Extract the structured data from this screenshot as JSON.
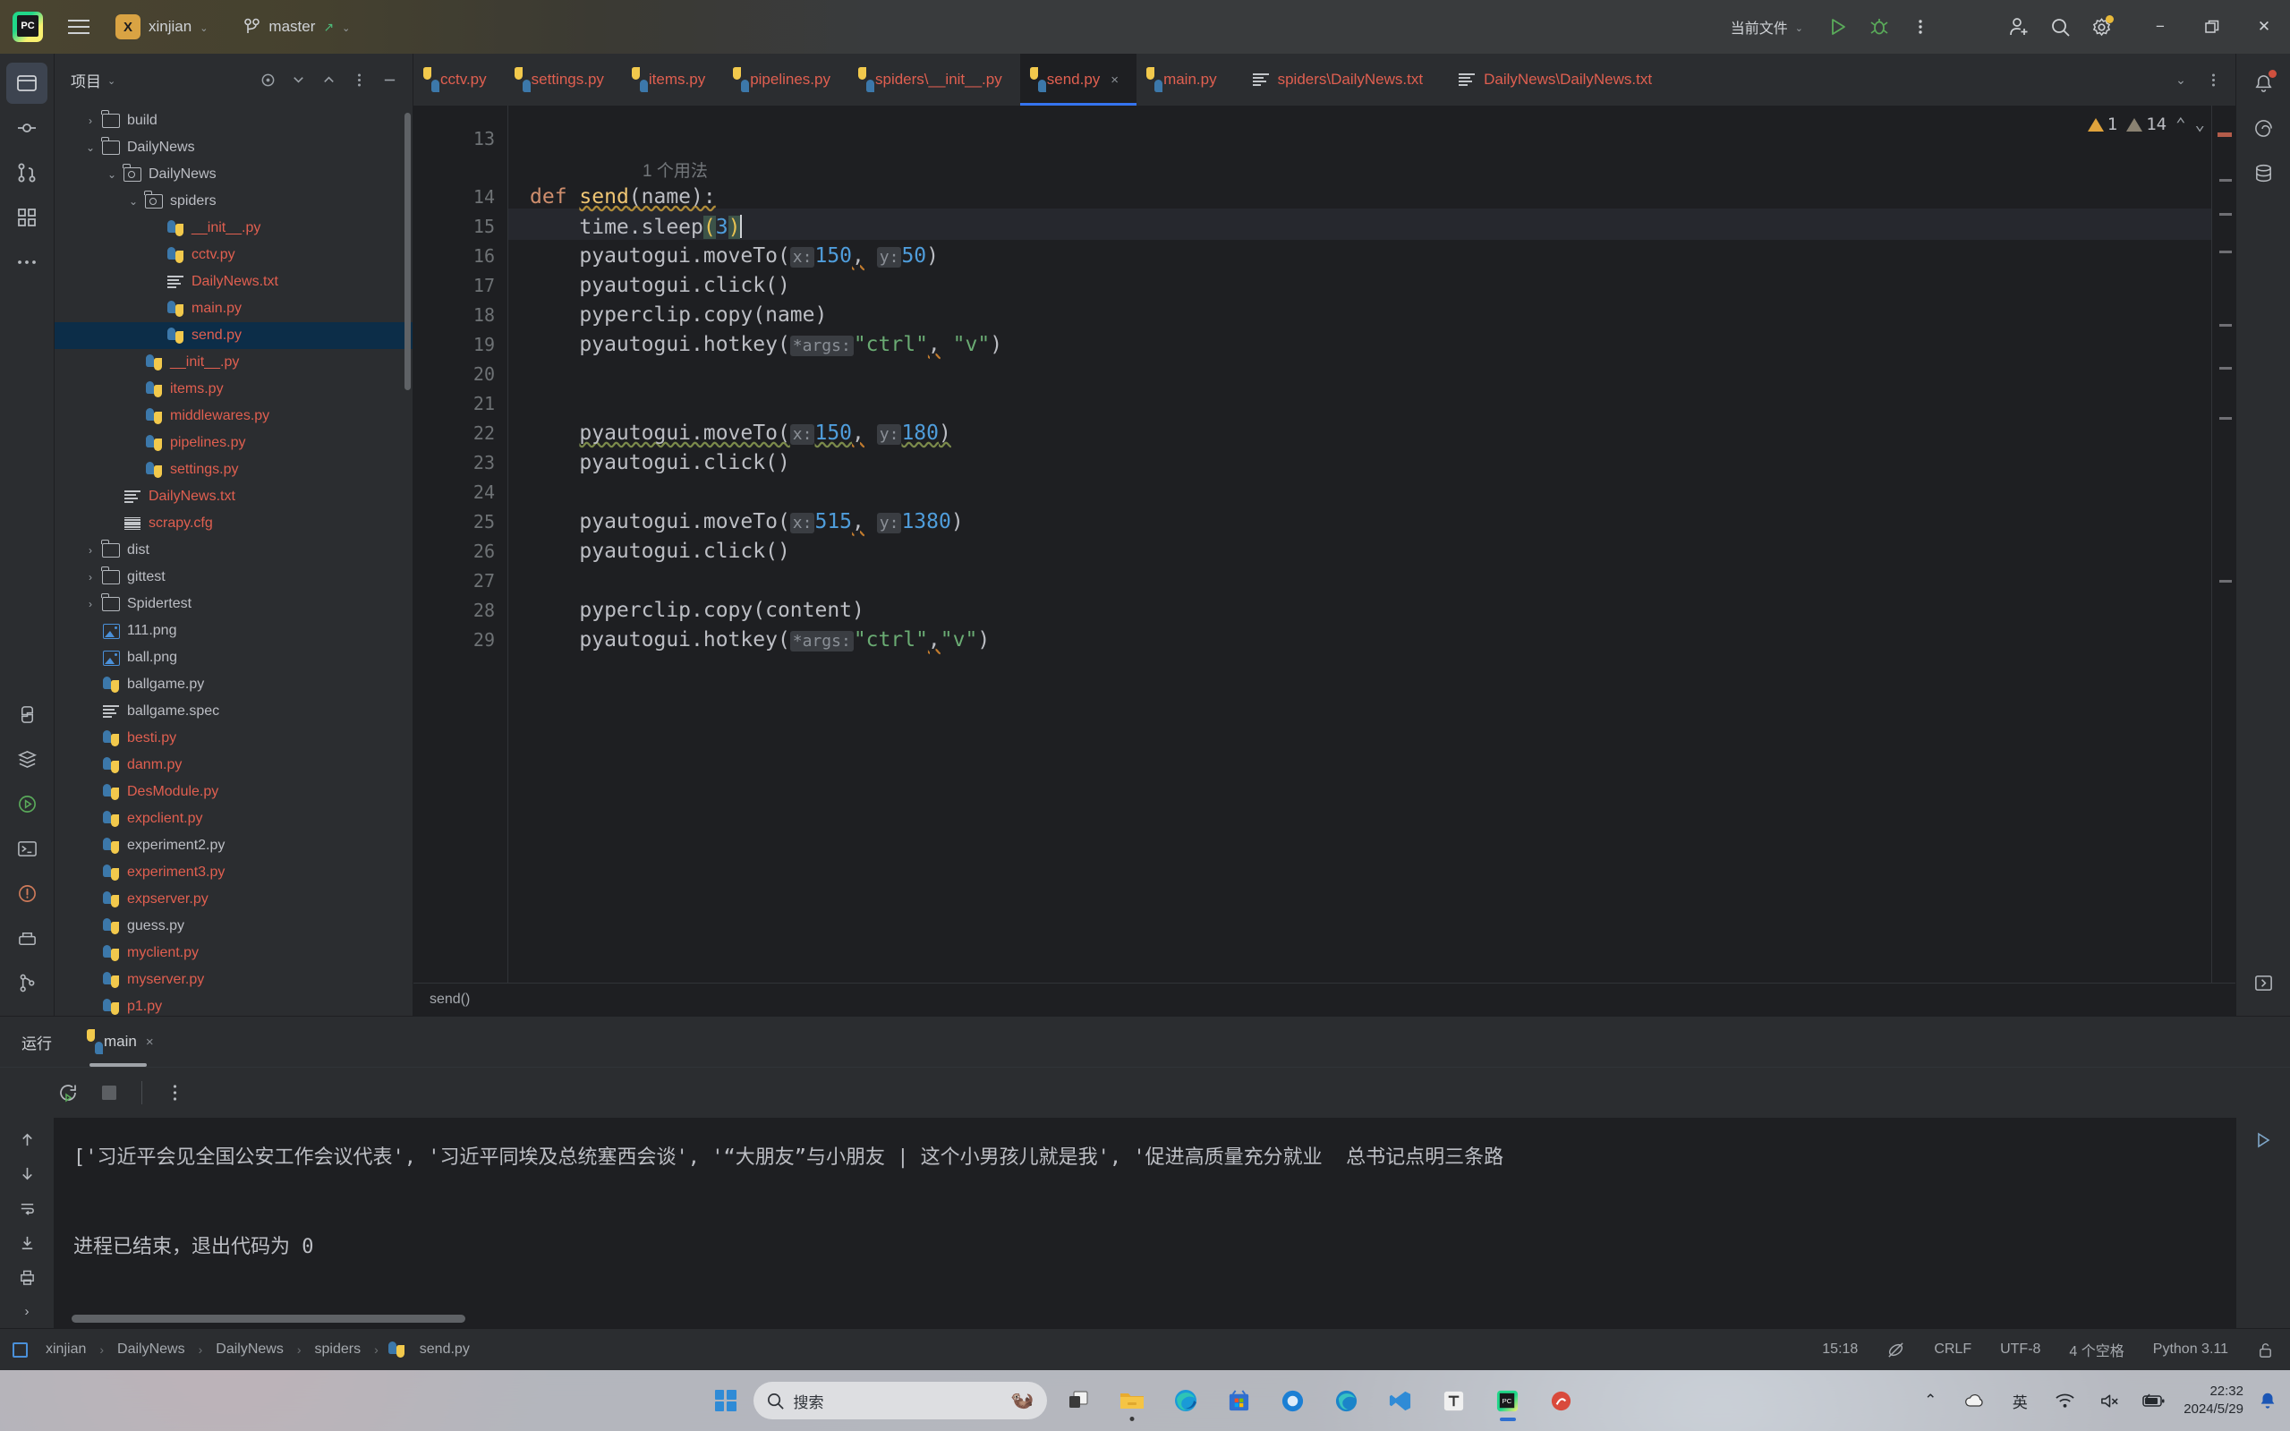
{
  "titlebar": {
    "project_name": "xinjian",
    "project_badge": "X",
    "branch": "master",
    "run_config": "当前文件",
    "icons": {
      "menu": "hamburger-icon",
      "run": "run-icon",
      "debug": "debug-icon",
      "more": "more-vertical-icon",
      "account": "account-icon",
      "search": "search-icon",
      "settings": "gear-icon",
      "minimize": "minimize-icon",
      "maximize": "maximize-icon",
      "close": "close-icon"
    }
  },
  "project_panel": {
    "title": "项目",
    "tree": [
      {
        "indent": 1,
        "arrow": "›",
        "icon": "folder",
        "label": "build",
        "color": "grey",
        "sel": false
      },
      {
        "indent": 1,
        "arrow": "⌄",
        "icon": "folder",
        "label": "DailyNews",
        "color": "grey",
        "sel": false
      },
      {
        "indent": 2,
        "arrow": "⌄",
        "icon": "package",
        "label": "DailyNews",
        "color": "grey",
        "sel": false
      },
      {
        "indent": 3,
        "arrow": "⌄",
        "icon": "package",
        "label": "spiders",
        "color": "grey",
        "sel": false
      },
      {
        "indent": 4,
        "arrow": "",
        "icon": "py",
        "label": "__init__.py",
        "color": "red",
        "sel": false
      },
      {
        "indent": 4,
        "arrow": "",
        "icon": "py",
        "label": "cctv.py",
        "color": "red",
        "sel": false
      },
      {
        "indent": 4,
        "arrow": "",
        "icon": "txt",
        "label": "DailyNews.txt",
        "color": "red",
        "sel": false
      },
      {
        "indent": 4,
        "arrow": "",
        "icon": "py",
        "label": "main.py",
        "color": "red",
        "sel": false
      },
      {
        "indent": 4,
        "arrow": "",
        "icon": "py",
        "label": "send.py",
        "color": "red",
        "sel": true
      },
      {
        "indent": 3,
        "arrow": "",
        "icon": "py",
        "label": "__init__.py",
        "color": "red",
        "sel": false
      },
      {
        "indent": 3,
        "arrow": "",
        "icon": "py",
        "label": "items.py",
        "color": "red",
        "sel": false
      },
      {
        "indent": 3,
        "arrow": "",
        "icon": "py",
        "label": "middlewares.py",
        "color": "red",
        "sel": false
      },
      {
        "indent": 3,
        "arrow": "",
        "icon": "py",
        "label": "pipelines.py",
        "color": "red",
        "sel": false
      },
      {
        "indent": 3,
        "arrow": "",
        "icon": "py",
        "label": "settings.py",
        "color": "red",
        "sel": false
      },
      {
        "indent": 2,
        "arrow": "",
        "icon": "txt",
        "label": "DailyNews.txt",
        "color": "red",
        "sel": false
      },
      {
        "indent": 2,
        "arrow": "",
        "icon": "cfg",
        "label": "scrapy.cfg",
        "color": "red",
        "sel": false
      },
      {
        "indent": 1,
        "arrow": "›",
        "icon": "folder",
        "label": "dist",
        "color": "grey",
        "sel": false
      },
      {
        "indent": 1,
        "arrow": "›",
        "icon": "folder",
        "label": "gittest",
        "color": "grey",
        "sel": false
      },
      {
        "indent": 1,
        "arrow": "›",
        "icon": "folder",
        "label": "Spidertest",
        "color": "grey",
        "sel": false
      },
      {
        "indent": 1,
        "arrow": "",
        "icon": "img",
        "label": "111.png",
        "color": "grey",
        "sel": false
      },
      {
        "indent": 1,
        "arrow": "",
        "icon": "img",
        "label": "ball.png",
        "color": "grey",
        "sel": false
      },
      {
        "indent": 1,
        "arrow": "",
        "icon": "py",
        "label": "ballgame.py",
        "color": "grey",
        "sel": false
      },
      {
        "indent": 1,
        "arrow": "",
        "icon": "txt",
        "label": "ballgame.spec",
        "color": "grey",
        "sel": false
      },
      {
        "indent": 1,
        "arrow": "",
        "icon": "py",
        "label": "besti.py",
        "color": "red",
        "sel": false
      },
      {
        "indent": 1,
        "arrow": "",
        "icon": "py",
        "label": "danm.py",
        "color": "red",
        "sel": false
      },
      {
        "indent": 1,
        "arrow": "",
        "icon": "py",
        "label": "DesModule.py",
        "color": "red",
        "sel": false
      },
      {
        "indent": 1,
        "arrow": "",
        "icon": "py",
        "label": "expclient.py",
        "color": "red",
        "sel": false
      },
      {
        "indent": 1,
        "arrow": "",
        "icon": "py",
        "label": "experiment2.py",
        "color": "grey",
        "sel": false
      },
      {
        "indent": 1,
        "arrow": "",
        "icon": "py",
        "label": "experiment3.py",
        "color": "red",
        "sel": false
      },
      {
        "indent": 1,
        "arrow": "",
        "icon": "py",
        "label": "expserver.py",
        "color": "red",
        "sel": false
      },
      {
        "indent": 1,
        "arrow": "",
        "icon": "py",
        "label": "guess.py",
        "color": "grey",
        "sel": false
      },
      {
        "indent": 1,
        "arrow": "",
        "icon": "py",
        "label": "myclient.py",
        "color": "red",
        "sel": false
      },
      {
        "indent": 1,
        "arrow": "",
        "icon": "py",
        "label": "myserver.py",
        "color": "red",
        "sel": false
      },
      {
        "indent": 1,
        "arrow": "",
        "icon": "py",
        "label": "p1.py",
        "color": "red",
        "sel": false
      }
    ]
  },
  "editor": {
    "tabs": [
      {
        "label": "cctv.py",
        "icon": "py",
        "active": false,
        "closable": false
      },
      {
        "label": "settings.py",
        "icon": "py",
        "active": false,
        "closable": false
      },
      {
        "label": "items.py",
        "icon": "py",
        "active": false,
        "closable": false
      },
      {
        "label": "pipelines.py",
        "icon": "py",
        "active": false,
        "closable": false
      },
      {
        "label": "spiders\\__init__.py",
        "icon": "py",
        "active": false,
        "closable": false
      },
      {
        "label": "send.py",
        "icon": "py",
        "active": true,
        "closable": true
      },
      {
        "label": "main.py",
        "icon": "py",
        "active": false,
        "closable": false
      },
      {
        "label": "spiders\\DailyNews.txt",
        "icon": "txt",
        "active": false,
        "closable": false
      },
      {
        "label": "DailyNews\\DailyNews.txt",
        "icon": "txt",
        "active": false,
        "closable": false
      }
    ],
    "tab_close_glyph": "×",
    "inspection": {
      "warnings": "1",
      "weak_warnings": "14",
      "up": "⌃",
      "down": "⌄"
    },
    "usage_hint": "1 个用法",
    "breadcrumb": "send()",
    "line_numbers": [
      "13",
      "14",
      "15",
      "16",
      "17",
      "18",
      "19",
      "20",
      "21",
      "22",
      "23",
      "24",
      "25",
      "26",
      "27",
      "28",
      "29"
    ],
    "code": {
      "l14_def": "def",
      "l14_name": "send",
      "l14_rest": "(name):",
      "l15": "time.sleep",
      "l15_open": "(",
      "l15_num": "3",
      "l15_close": ")",
      "l16_call": "pyautogui.moveTo(",
      "l16_px": "x:",
      "l16_x": "150",
      "l16_py": "y:",
      "l16_y": "50",
      "l17": "pyautogui.click()",
      "l18": "pyperclip.copy(name)",
      "l19_call": "pyautogui.hotkey(",
      "l19_args": "*args:",
      "l19_s1": "\"ctrl\"",
      "l19_s2": "\"v\"",
      "l22_call": "pyautogui.moveTo(",
      "l22_px": "x:",
      "l22_x": "150",
      "l22_py": "y:",
      "l22_y": "180",
      "l23": "pyautogui.click()",
      "l25_call": "pyautogui.moveTo(",
      "l25_px": "x:",
      "l25_x": "515",
      "l25_py": "y:",
      "l25_y": "1380",
      "l26": "pyautogui.click()",
      "l28": "pyperclip.copy(content)",
      "l29_call": "pyautogui.hotkey(",
      "l29_args": "*args:",
      "l29_s1": "\"ctrl\"",
      "l29_s2": "\"v\""
    }
  },
  "run_window": {
    "title": "运行",
    "tab_label": "main",
    "tab_icon": "py",
    "tab_close": "×",
    "toolbar": {
      "rerun": "rerun-icon",
      "stop": "stop-icon",
      "more": "more-vertical-icon"
    },
    "console_lines": [
      "['习近平会见全国公安工作会议代表', '习近平同埃及总统塞西会谈', '“大朋友”与小朋友 | 这个小男孩儿就是我', '促进高质量充分就业  总书记点明三条路",
      "进程已结束，退出代码为 0"
    ]
  },
  "status_bar": {
    "breadcrumbs": [
      "xinjian",
      "DailyNews",
      "DailyNews",
      "spiders",
      "send.py"
    ],
    "separator": "›",
    "time": "15:18",
    "line_sep": "CRLF",
    "encoding": "UTF-8",
    "indent": "4 个空格",
    "interpreter": "Python 3.11",
    "lock": "unlocked-icon"
  },
  "taskbar": {
    "search_placeholder": "搜索",
    "search_mascot": "🦦",
    "apps": [
      {
        "name": "task-view-icon"
      },
      {
        "name": "file-explorer-icon"
      },
      {
        "name": "edge-icon"
      },
      {
        "name": "microsoft-store-icon"
      },
      {
        "name": "app-blue-icon"
      },
      {
        "name": "edge-alt-icon"
      },
      {
        "name": "vscode-icon"
      },
      {
        "name": "typora-icon"
      },
      {
        "name": "pycharm-icon"
      },
      {
        "name": "pinned-app-icon"
      }
    ],
    "tray": {
      "chevron": "⌃",
      "cloud": "cloud-icon",
      "ime": "英",
      "wifi": "wifi-icon",
      "volume": "volume-muted-icon",
      "battery": "battery-charging-icon",
      "time": "22:32",
      "date": "2024/5/29",
      "notification": "bell-icon"
    }
  }
}
